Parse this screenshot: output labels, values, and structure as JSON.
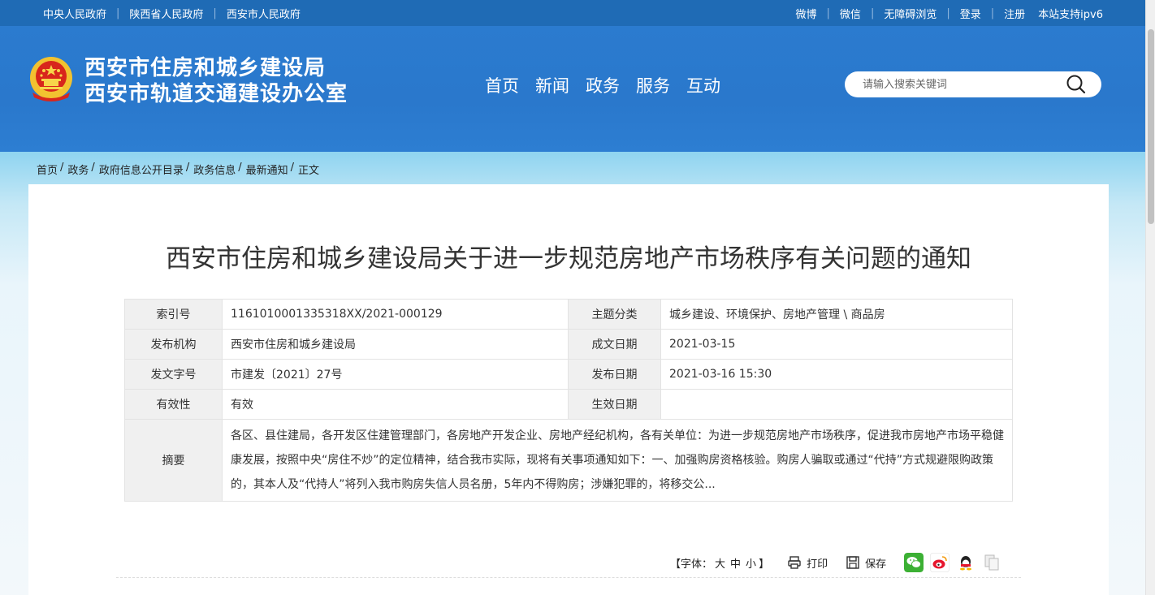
{
  "topbar": {
    "left_links": [
      "中央人民政府",
      "陕西省人民政府",
      "西安市人民政府"
    ],
    "right_links": [
      "微博",
      "微信",
      "无障碍浏览",
      "登录",
      "注册"
    ],
    "ipv6_text": "本站支持ipv6"
  },
  "header": {
    "title_line1": "西安市住房和城乡建设局",
    "title_line2": "西安市轨道交通建设办公室",
    "nav": [
      "首页",
      "新闻",
      "政务",
      "服务",
      "互动"
    ],
    "search_placeholder": "请输入搜索关键词"
  },
  "breadcrumb": [
    "首页",
    "政务",
    "政府信息公开目录",
    "政务信息",
    "最新通知",
    "正文"
  ],
  "document": {
    "title": "西安市住房和城乡建设局关于进一步规范房地产市场秩序有关问题的通知",
    "meta": {
      "index_label": "索引号",
      "index_value": "1161010001335318XX/2021-000129",
      "topic_label": "主题分类",
      "topic_value": "城乡建设、环境保护、房地产管理 \\ 商品房",
      "publisher_label": "发布机构",
      "publisher_value": "西安市住房和城乡建设局",
      "created_label": "成文日期",
      "created_value": "2021-03-15",
      "docno_label": "发文字号",
      "docno_value": "市建发〔2021〕27号",
      "published_label": "发布日期",
      "published_value": "2021-03-16 15:30",
      "validity_label": "有效性",
      "validity_value": "有效",
      "effective_label": "生效日期",
      "effective_value": "",
      "abstract_label": "摘要",
      "abstract_value": "各区、县住建局，各开发区住建管理部门，各房地产开发企业、房地产经纪机构，各有关单位：为进一步规范房地产市场秩序，促进我市房地产市场平稳健康发展，按照中央“房住不炒”的定位精神，结合我市实际，现将有关事项通知如下：一、加强购房资格核验。购房人骗取或通过“代持”方式规避限购政策的，其本人及“代持人”将列入我市购房失信人员名册，5年内不得购房；涉嫌犯罪的，将移交公..."
    }
  },
  "tools": {
    "font_label": "【字体：",
    "font_large": "大",
    "font_medium": "中",
    "font_small": "小",
    "font_close": "】",
    "print_label": "打印",
    "save_label": "保存"
  },
  "colors": {
    "topbar_bg": "#1f6bb5",
    "header_bg": "#2a78cc",
    "label_bg": "#f0f0f0"
  }
}
